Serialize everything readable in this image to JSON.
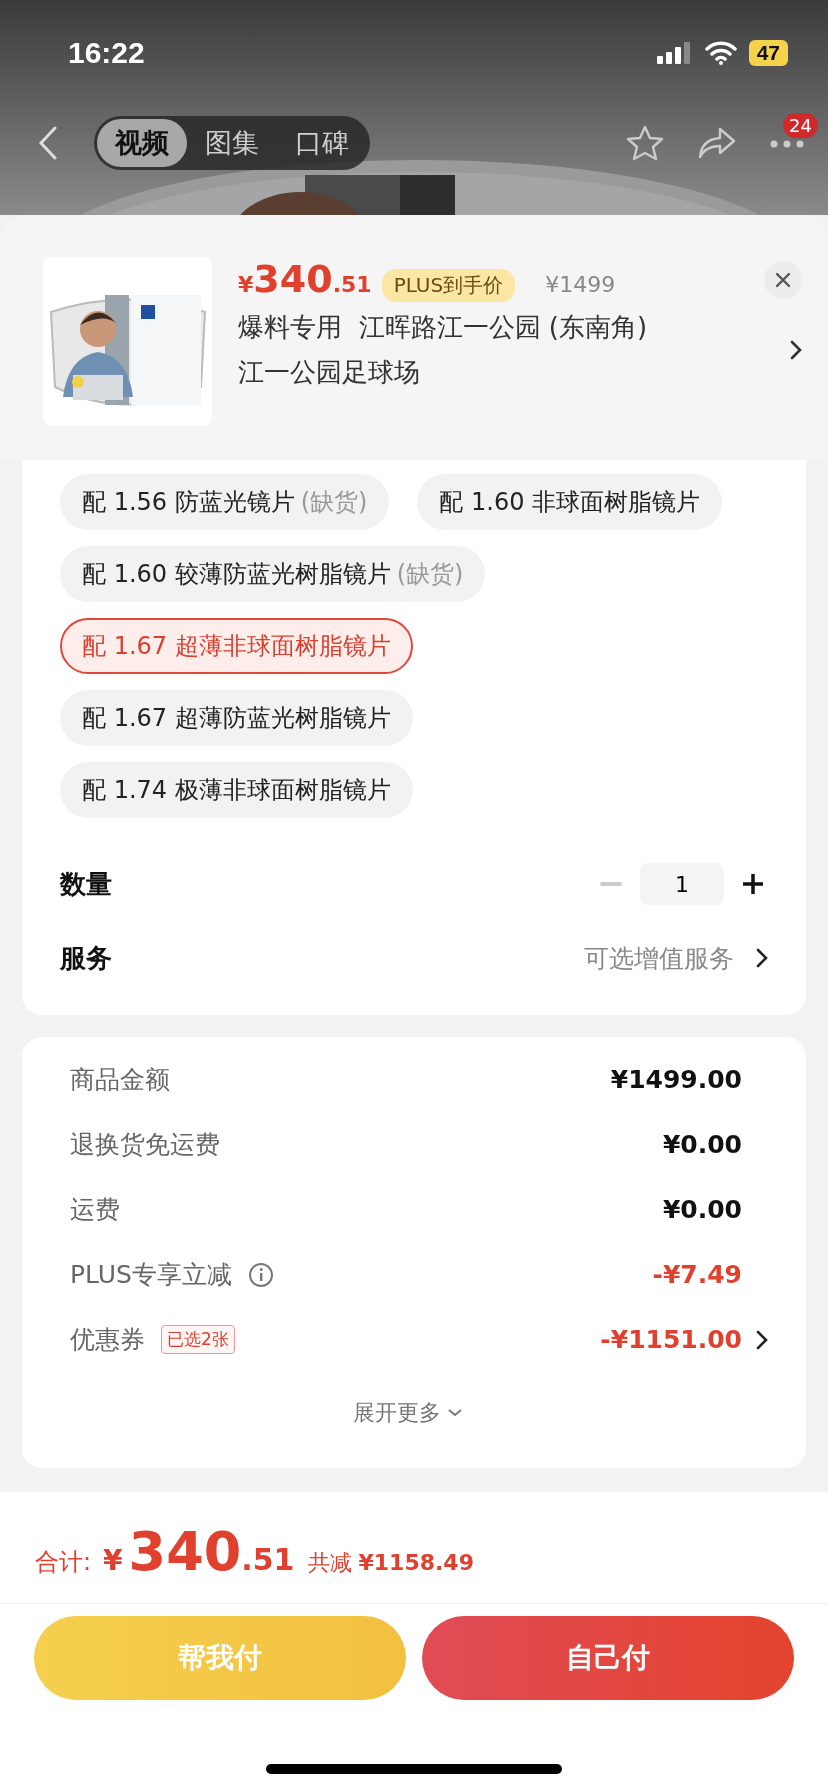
{
  "status_bar": {
    "time": "16:22",
    "battery": "47"
  },
  "nav": {
    "tabs": [
      {
        "label": "视频",
        "selected": true
      },
      {
        "label": "图集",
        "selected": false
      },
      {
        "label": "口碑",
        "selected": false
      }
    ],
    "more_badge": "24"
  },
  "product": {
    "image": {
      "kind": "picture"
    },
    "price_symbol": "¥",
    "price_int": "340",
    "price_dec": ".51",
    "plus_badge": "PLUS到手价",
    "original_price": "¥1499",
    "title_lines": [
      "爆料专用  江晖路江一公园 (东南角)",
      "江一公园足球场"
    ]
  },
  "options": [
    {
      "label": "配 1.56 防蓝光镜片",
      "note": "(缺货)",
      "selected": false
    },
    {
      "label": "配 1.60 非球面树脂镜片",
      "selected": false
    },
    {
      "label": "配 1.60 较薄防蓝光树脂镜片",
      "note": "(缺货)",
      "selected": false
    },
    {
      "label": "配 1.67 超薄非球面树脂镜片",
      "selected": true
    },
    {
      "label": "配 1.67 超薄防蓝光树脂镜片",
      "selected": false
    },
    {
      "label": "配 1.74 极薄非球面树脂镜片",
      "selected": false
    }
  ],
  "quantity": {
    "label": "数量",
    "value": "1",
    "minus_disabled": true
  },
  "service": {
    "label": "服务",
    "value": "可选增值服务"
  },
  "summary": {
    "rows": [
      {
        "kind": "plain",
        "label": "商品金额",
        "value": "¥1499.00",
        "discount": false
      },
      {
        "kind": "plain",
        "label": "退换货免运费",
        "value": "¥0.00",
        "discount": false
      },
      {
        "kind": "plain",
        "label": "运费",
        "value": "¥0.00",
        "discount": false
      },
      {
        "kind": "info",
        "label": "PLUS专享立减",
        "value": "-¥7.49",
        "discount": true
      },
      {
        "kind": "coupon",
        "label": "优惠券",
        "badge": "已选2张",
        "value": "-¥1151.00",
        "discount": true
      }
    ],
    "expand": "展开更多"
  },
  "total": {
    "label": "合计:",
    "symbol": "¥",
    "int": "340",
    "dec": ".51",
    "saved_label": "共减",
    "saved": "¥1158.49"
  },
  "buttons": [
    {
      "kind": "secondary",
      "label": "帮我付"
    },
    {
      "kind": "primary",
      "label": "自己付"
    }
  ]
}
